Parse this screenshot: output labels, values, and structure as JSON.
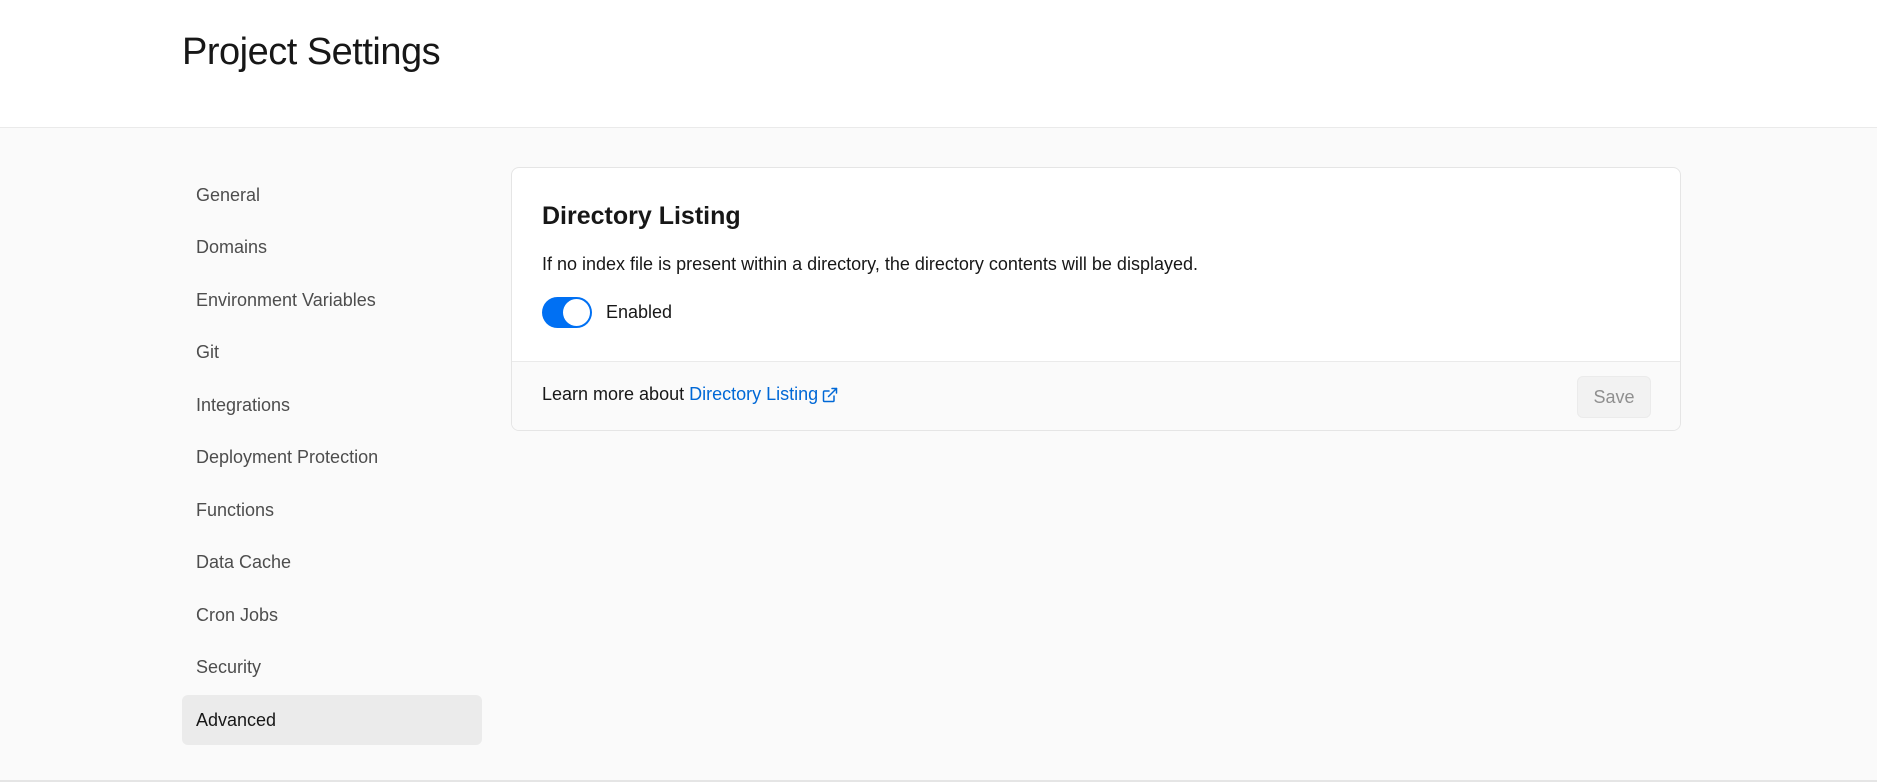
{
  "header": {
    "title": "Project Settings"
  },
  "sidebar": {
    "items": [
      {
        "label": "General",
        "active": false
      },
      {
        "label": "Domains",
        "active": false
      },
      {
        "label": "Environment Variables",
        "active": false
      },
      {
        "label": "Git",
        "active": false
      },
      {
        "label": "Integrations",
        "active": false
      },
      {
        "label": "Deployment Protection",
        "active": false
      },
      {
        "label": "Functions",
        "active": false
      },
      {
        "label": "Data Cache",
        "active": false
      },
      {
        "label": "Cron Jobs",
        "active": false
      },
      {
        "label": "Security",
        "active": false
      },
      {
        "label": "Advanced",
        "active": true
      }
    ]
  },
  "card": {
    "title": "Directory Listing",
    "description": "If no index file is present within a directory, the directory contents will be displayed.",
    "toggle": {
      "label": "Enabled",
      "checked": true
    },
    "footer": {
      "text": "Learn more about",
      "link_label": "Directory Listing",
      "link_icon": "external-link-icon",
      "save_label": "Save",
      "save_disabled": true
    }
  },
  "colors": {
    "accent": "#0070f3",
    "link": "#0068d6",
    "page_bg": "#fafafa",
    "active_item_bg": "#ebebeb"
  }
}
